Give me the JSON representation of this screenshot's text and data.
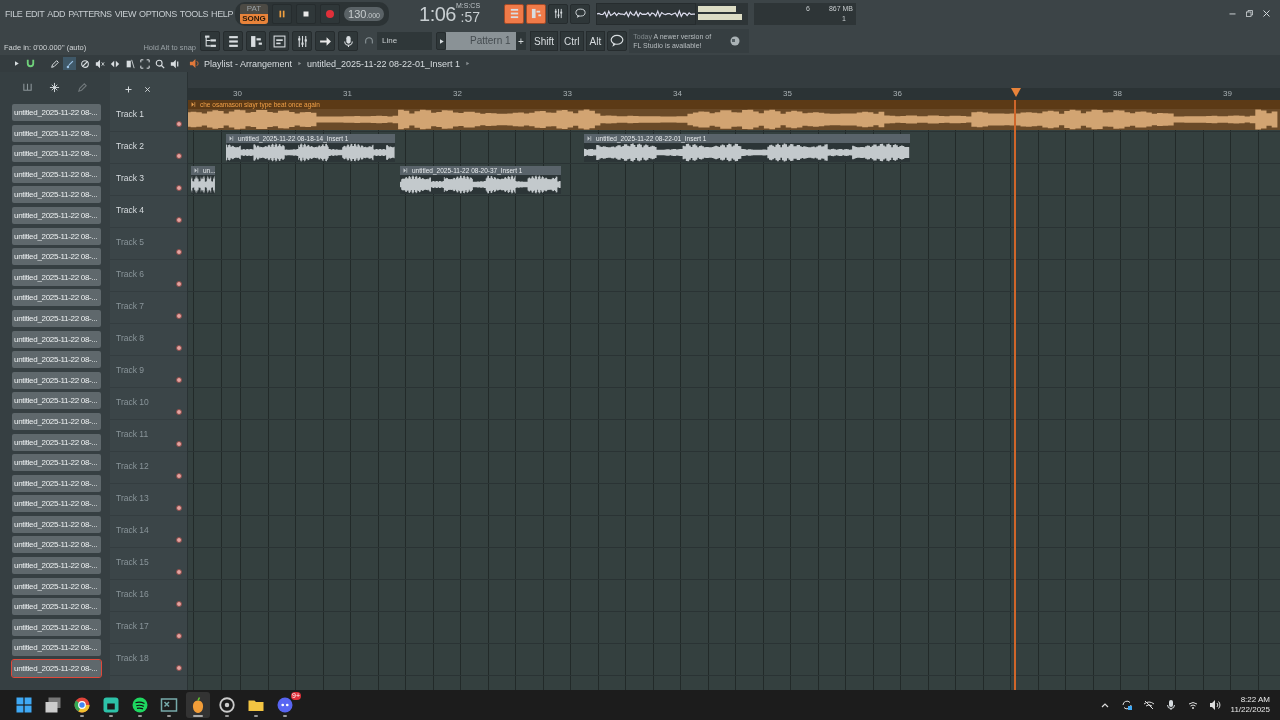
{
  "menu": [
    "FILE",
    "EDIT",
    "ADD",
    "PATTERNS",
    "VIEW",
    "OPTIONS",
    "TOOLS",
    "HELP"
  ],
  "transport": {
    "modes": [
      {
        "label": "PAT",
        "selected": false
      },
      {
        "label": "SONG",
        "selected": true
      }
    ],
    "playing": true,
    "tempo": "130",
    "tempo_fraction": ".000"
  },
  "clock": {
    "time": "1:06",
    "fraction": ":57",
    "unit": "M:S:CS"
  },
  "monitor": {
    "cpu": "6",
    "memory": "867 MB",
    "polyphony": "1"
  },
  "hint": {
    "label": "Fade in:",
    "value": "0'00.000'' (auto)",
    "tip": "Hold Alt to snap"
  },
  "snap": {
    "value": "Line"
  },
  "pattern": {
    "name": "Pattern 1",
    "add": "+"
  },
  "modifiers": [
    "Shift",
    "Ctrl",
    "Alt"
  ],
  "news": {
    "day": "Today",
    "message": "A newer version of FL Studio is available!"
  },
  "playlist": {
    "title": "Playlist - Arrangement",
    "breadcrumb": "untitled_2025-11-22 08-22-01_Insert 1",
    "tools": [
      {
        "kind": "pencil",
        "selected": false
      },
      {
        "kind": "brush",
        "selected": true
      },
      {
        "kind": "delete",
        "selected": false
      },
      {
        "kind": "mute",
        "selected": false
      },
      {
        "kind": "slip",
        "selected": false
      },
      {
        "kind": "slice",
        "selected": false
      },
      {
        "kind": "select",
        "selected": false
      },
      {
        "kind": "zoom",
        "selected": false
      },
      {
        "kind": "playback",
        "selected": false
      }
    ]
  },
  "browser": {
    "items": [
      {
        "label": "untitled_2025-11-22 08-...",
        "selected": false
      },
      {
        "label": "untitled_2025-11-22 08-...",
        "selected": false
      },
      {
        "label": "untitled_2025-11-22 08-...",
        "selected": false
      },
      {
        "label": "untitled_2025-11-22 08-...",
        "selected": false
      },
      {
        "label": "untitled_2025-11-22 08-...",
        "selected": false
      },
      {
        "label": "untitled_2025-11-22 08-...",
        "selected": false
      },
      {
        "label": "untitled_2025-11-22 08-...",
        "selected": false
      },
      {
        "label": "untitled_2025-11-22 08-...",
        "selected": false
      },
      {
        "label": "untitled_2025-11-22 08-...",
        "selected": false
      },
      {
        "label": "untitled_2025-11-22 08-...",
        "selected": false
      },
      {
        "label": "untitled_2025-11-22 08-...",
        "selected": false
      },
      {
        "label": "untitled_2025-11-22 08-...",
        "selected": false
      },
      {
        "label": "untitled_2025-11-22 08-...",
        "selected": false
      },
      {
        "label": "untitled_2025-11-22 08-...",
        "selected": false
      },
      {
        "label": "untitled_2025-11-22 08-...",
        "selected": false
      },
      {
        "label": "untitled_2025-11-22 08-...",
        "selected": false
      },
      {
        "label": "untitled_2025-11-22 08-...",
        "selected": false
      },
      {
        "label": "untitled_2025-11-22 08-...",
        "selected": false
      },
      {
        "label": "untitled_2025-11-22 08-...",
        "selected": false
      },
      {
        "label": "untitled_2025-11-22 08-...",
        "selected": false
      },
      {
        "label": "untitled_2025-11-22 08-...",
        "selected": false
      },
      {
        "label": "untitled_2025-11-22 08-...",
        "selected": false
      },
      {
        "label": "untitled_2025-11-22 08-...",
        "selected": false
      },
      {
        "label": "untitled_2025-11-22 08-...",
        "selected": false
      },
      {
        "label": "untitled_2025-11-22 08-...",
        "selected": false
      },
      {
        "label": "untitled_2025-11-22 08-...",
        "selected": false
      },
      {
        "label": "untitled_2025-11-22 08-...",
        "selected": false
      },
      {
        "label": "untitled_2025-11-22 08-...",
        "selected": true
      }
    ]
  },
  "timeline": {
    "marks": [
      "30",
      "31",
      "32",
      "33",
      "34",
      "35",
      "36",
      "38",
      "39"
    ]
  },
  "tracks": [
    {
      "name": "Track 1",
      "has_content": true,
      "enabled": true,
      "clips": [
        {
          "title": "che osamason slayr type beat once again",
          "color": "#d2a472"
        }
      ]
    },
    {
      "name": "Track 2",
      "has_content": true,
      "enabled": true,
      "clips": [
        {
          "title": "untitled_2025-11-22 08-18-14_Insert 1",
          "color": "#c3c9cc"
        },
        {
          "title": "untitled_2025-11-22 08-22-01_Insert 1",
          "color": "#c3c9cc"
        }
      ]
    },
    {
      "name": "Track 3",
      "has_content": true,
      "enabled": true,
      "clips": [
        {
          "title": "un...",
          "color": "#c3c9cc"
        },
        {
          "title": "untitled_2025-11-22 08-20-37_Insert 1",
          "color": "#c3c9cc"
        }
      ]
    },
    {
      "name": "Track 4",
      "has_content": true,
      "enabled": true
    },
    {
      "name": "Track 5",
      "has_content": false,
      "enabled": true
    },
    {
      "name": "Track 6",
      "has_content": false,
      "enabled": true
    },
    {
      "name": "Track 7",
      "has_content": false,
      "enabled": true
    },
    {
      "name": "Track 8",
      "has_content": false,
      "enabled": true
    },
    {
      "name": "Track 9",
      "has_content": false,
      "enabled": true
    },
    {
      "name": "Track 10",
      "has_content": false,
      "enabled": true
    },
    {
      "name": "Track 11",
      "has_content": false,
      "enabled": true
    },
    {
      "name": "Track 12",
      "has_content": false,
      "enabled": true
    },
    {
      "name": "Track 13",
      "has_content": false,
      "enabled": true
    },
    {
      "name": "Track 14",
      "has_content": false,
      "enabled": true
    },
    {
      "name": "Track 15",
      "has_content": false,
      "enabled": true
    },
    {
      "name": "Track 16",
      "has_content": false,
      "enabled": true
    },
    {
      "name": "Track 17",
      "has_content": false,
      "enabled": true
    },
    {
      "name": "Track 18",
      "has_content": false,
      "enabled": true
    }
  ],
  "taskbar": {
    "apps": [
      {
        "kind": "windows",
        "selected": false,
        "running": false
      },
      {
        "kind": "taskview",
        "selected": false,
        "running": false
      },
      {
        "kind": "browser",
        "selected": false,
        "running": true
      },
      {
        "kind": "store",
        "selected": false,
        "running": true
      },
      {
        "kind": "music",
        "selected": false,
        "running": true
      },
      {
        "kind": "terminal",
        "selected": false,
        "running": true
      },
      {
        "kind": "daw",
        "selected": true,
        "running": true
      },
      {
        "kind": "recorder",
        "selected": false,
        "running": true
      },
      {
        "kind": "folder",
        "selected": false,
        "running": true
      },
      {
        "kind": "chat",
        "selected": false,
        "running": true,
        "badge": "9+"
      }
    ],
    "tray": [
      {
        "kind": "chevron"
      },
      {
        "kind": "sync"
      },
      {
        "kind": "network"
      },
      {
        "kind": "mic"
      },
      {
        "kind": "wifi"
      },
      {
        "kind": "volume"
      }
    ],
    "time": "8:22 AM",
    "date": "11/22/2025"
  }
}
